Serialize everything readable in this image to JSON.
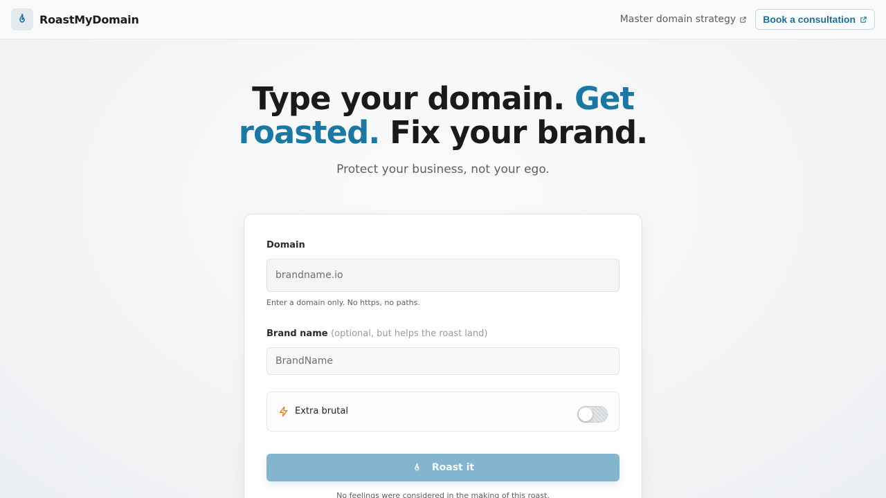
{
  "header": {
    "brand_name": "RoastMyDomain",
    "brand_icon": "flame-icon",
    "nav_link": "Master domain strategy",
    "cta_label": "Book a consultation",
    "external_icon": "external-link-icon"
  },
  "hero": {
    "title_part1": "Type your domain.",
    "title_accent": "Get roasted.",
    "title_part2": "Fix your brand.",
    "subtitle": "Protect your business, not your ego."
  },
  "form": {
    "domain_label": "Domain",
    "domain_placeholder": "brandname.io",
    "domain_hint": "Enter a domain only. No https, no paths.",
    "brand_label": "Brand name",
    "brand_label_note": "(optional, but helps the roast land)",
    "brand_placeholder": "BrandName",
    "toggle_label": "Extra brutal",
    "toggle_icon": "lightning-icon",
    "toggle_on": false,
    "submit_label": "Roast it",
    "submit_icon": "flame-icon",
    "disclaimer": "No feelings were considered in the making of this roast."
  },
  "colors": {
    "accent": "#1c77a3",
    "button": "#84b5cf",
    "bolt": "#d9822b"
  }
}
